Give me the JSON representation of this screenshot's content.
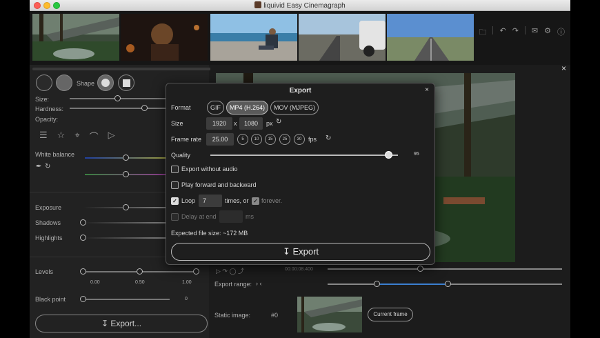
{
  "window": {
    "title": "liquivid Easy Cinemagraph"
  },
  "toolbar_icons": [
    "folder-icon",
    "undo-icon",
    "redo-icon",
    "mail-icon",
    "settings-icon",
    "info-icon"
  ],
  "left_panel": {
    "shape_label": "Shape",
    "size_label": "Size:",
    "hardness_label": "Hardness:",
    "opacity_label": "Opacity:",
    "white_balance_label": "White balance",
    "exposure_label": "Exposure",
    "shadows_label": "Shadows",
    "highlights_label": "Highlights",
    "levels_label": "Levels",
    "levels_ticks": [
      "0.00",
      "0.50",
      "1.00"
    ],
    "black_point_label": "Black point",
    "black_point_value": "0",
    "export_button": "Export..."
  },
  "right_panel": {
    "timecode": "00:00:08.400",
    "export_range_label": "Export range:",
    "static_image_label": "Static image:",
    "static_image_value": "#0",
    "current_frame_button": "Current frame"
  },
  "export_dialog": {
    "title": "Export",
    "close": "×",
    "format_label": "Format",
    "formats": [
      "GIF",
      "MP4 (H.264)",
      "MOV (MJPEG)"
    ],
    "selected_format": "MP4 (H.264)",
    "size_label": "Size",
    "width": "1920",
    "x_sep": "x",
    "height": "1080",
    "px_unit": "px",
    "frame_rate_label": "Frame rate",
    "frame_rate": "25.00",
    "fps_presets": [
      "5",
      "10",
      "15",
      "25",
      "30"
    ],
    "fps_unit": "fps",
    "quality_label": "Quality",
    "quality_value": "95",
    "quality_fraction": 0.95,
    "export_without_audio": "Export without audio",
    "play_forward_backward": "Play forward and backward",
    "loop_label": "Loop",
    "loop_count": "7",
    "times_or": "times, or",
    "forever": "forever.",
    "delay_at_end": "Delay at end",
    "ms_unit": "ms",
    "expected_size": "Expected file size: ~172 MB",
    "export_button": "Export"
  }
}
